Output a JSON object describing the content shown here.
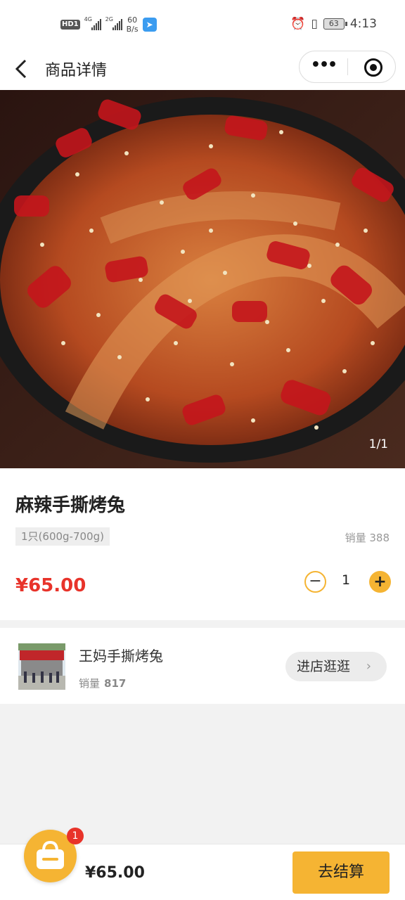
{
  "status_bar": {
    "hd_label": "HD",
    "hd_sub": "1",
    "net1": "4G",
    "net2": "2G",
    "speed_value": "60",
    "speed_unit": "B/s",
    "battery": "63",
    "time": "4:13"
  },
  "nav": {
    "back_icon": "chevron-left-icon",
    "title": "商品详情",
    "more_label": "•••"
  },
  "product": {
    "image_counter": "1/1",
    "name": "麻辣手撕烤兔",
    "spec": "1只(600g-700g)",
    "sales": "销量 388",
    "price": "¥65.00",
    "quantity": "1",
    "minus_label": "−",
    "plus_label": "+"
  },
  "store": {
    "name": "王妈手撕烤兔",
    "sales_label": "销量",
    "sales_value": "817",
    "visit_label": "进店逛逛",
    "visit_chevron": "›"
  },
  "cart": {
    "badge": "1",
    "total": "¥65.00",
    "checkout_label": "去结算"
  },
  "colors": {
    "accent": "#f5b433",
    "price_red": "#e8332a"
  }
}
